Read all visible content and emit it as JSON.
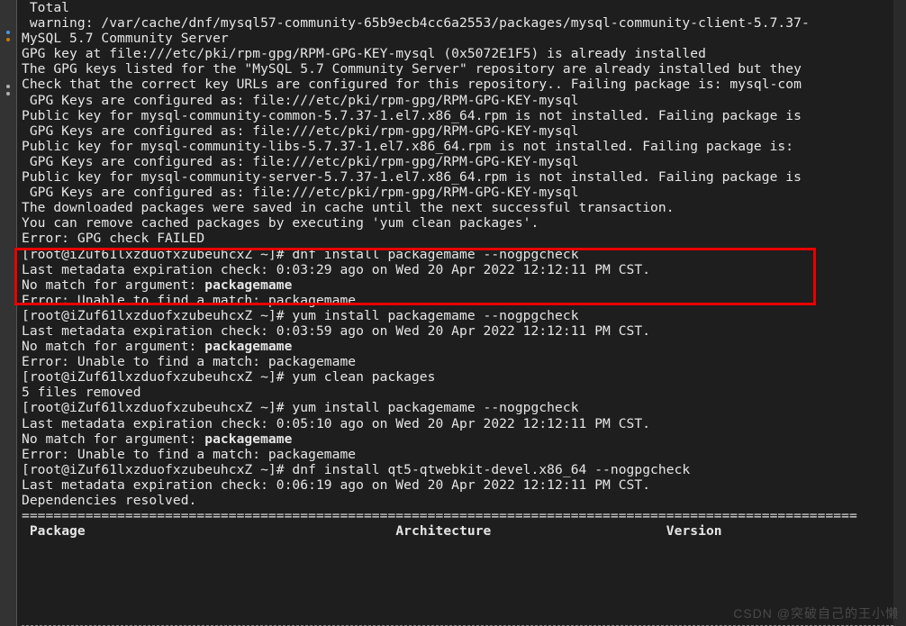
{
  "lines": [
    {
      "segs": [
        {
          "t": " Total"
        }
      ]
    },
    {
      "segs": [
        {
          "t": " warning: /var/cache/dnf/mysql57-community-65b9ecb4cc6a2553/packages/mysql-community-client-5.7.37-"
        }
      ]
    },
    {
      "segs": [
        {
          "t": "MySQL 5.7 Community Server"
        }
      ]
    },
    {
      "segs": [
        {
          "t": "GPG key at file:///etc/pki/rpm-gpg/RPM-GPG-KEY-mysql (0x5072E1F5) is already installed"
        }
      ]
    },
    {
      "segs": [
        {
          "t": "The GPG keys listed for the \"MySQL 5.7 Community Server\" repository are already installed but they"
        }
      ]
    },
    {
      "segs": [
        {
          "t": "Check that the correct key URLs are configured for this repository.. Failing package is: mysql-com"
        }
      ]
    },
    {
      "segs": [
        {
          "t": " GPG Keys are configured as: file:///etc/pki/rpm-gpg/RPM-GPG-KEY-mysql"
        }
      ]
    },
    {
      "segs": [
        {
          "t": "Public key for mysql-community-common-5.7.37-1.el7.x86_64.rpm is not installed. Failing package is"
        }
      ]
    },
    {
      "segs": [
        {
          "t": " GPG Keys are configured as: file:///etc/pki/rpm-gpg/RPM-GPG-KEY-mysql"
        }
      ]
    },
    {
      "segs": [
        {
          "t": "Public key for mysql-community-libs-5.7.37-1.el7.x86_64.rpm is not installed. Failing package is: "
        }
      ]
    },
    {
      "segs": [
        {
          "t": " GPG Keys are configured as: file:///etc/pki/rpm-gpg/RPM-GPG-KEY-mysql"
        }
      ]
    },
    {
      "segs": [
        {
          "t": "Public key for mysql-community-server-5.7.37-1.el7.x86_64.rpm is not installed. Failing package is"
        }
      ]
    },
    {
      "segs": [
        {
          "t": " GPG Keys are configured as: file:///etc/pki/rpm-gpg/RPM-GPG-KEY-mysql"
        }
      ]
    },
    {
      "segs": [
        {
          "t": "The downloaded packages were saved in cache until the next successful transaction."
        }
      ]
    },
    {
      "segs": [
        {
          "t": "You can remove cached packages by executing 'yum clean packages'."
        }
      ]
    },
    {
      "segs": [
        {
          "t": "Error: GPG check FAILED"
        }
      ]
    },
    {
      "segs": [
        {
          "t": "[root@iZuf61lxzduofxzubeuhcxZ ~]# dnf install packagemame --nogpgcheck"
        }
      ]
    },
    {
      "segs": [
        {
          "t": "Last metadata expiration check: 0:03:29 ago on Wed 20 Apr 2022 12:12:11 PM CST."
        }
      ]
    },
    {
      "segs": [
        {
          "t": "No match for argument: "
        },
        {
          "t": "packagemame",
          "b": true
        }
      ]
    },
    {
      "segs": [
        {
          "t": "Error: Unable to find a match: packagemame"
        }
      ]
    },
    {
      "segs": [
        {
          "t": "[root@iZuf61lxzduofxzubeuhcxZ ~]# yum install packagemame --nogpgcheck"
        }
      ]
    },
    {
      "segs": [
        {
          "t": "Last metadata expiration check: 0:03:59 ago on Wed 20 Apr 2022 12:12:11 PM CST."
        }
      ]
    },
    {
      "segs": [
        {
          "t": "No match for argument: "
        },
        {
          "t": "packagemame",
          "b": true
        }
      ]
    },
    {
      "segs": [
        {
          "t": "Error: Unable to find a match: packagemame"
        }
      ]
    },
    {
      "segs": [
        {
          "t": "[root@iZuf61lxzduofxzubeuhcxZ ~]# yum clean packages"
        }
      ]
    },
    {
      "segs": [
        {
          "t": "5 files removed"
        }
      ]
    },
    {
      "segs": [
        {
          "t": "[root@iZuf61lxzduofxzubeuhcxZ ~]# yum install packagemame --nogpgcheck"
        }
      ]
    },
    {
      "segs": [
        {
          "t": "Last metadata expiration check: 0:05:10 ago on Wed 20 Apr 2022 12:12:11 PM CST."
        }
      ]
    },
    {
      "segs": [
        {
          "t": "No match for argument: "
        },
        {
          "t": "packagemame",
          "b": true
        }
      ]
    },
    {
      "segs": [
        {
          "t": "Error: Unable to find a match: packagemame"
        }
      ]
    },
    {
      "segs": [
        {
          "t": "[root@iZuf61lxzduofxzubeuhcxZ ~]# dnf install qt5-qtwebkit-devel.x86_64 --nogpgcheck"
        }
      ]
    },
    {
      "segs": [
        {
          "t": "Last metadata expiration check: 0:06:19 ago on Wed 20 Apr 2022 12:12:11 PM CST."
        }
      ]
    },
    {
      "segs": [
        {
          "t": "Dependencies resolved."
        }
      ]
    },
    {
      "segs": [
        {
          "t": "========================================================================================================="
        }
      ]
    },
    {
      "segs": [
        {
          "t": " "
        },
        {
          "t": "Package",
          "b": true
        },
        {
          "t": "                                       "
        },
        {
          "t": "Architecture",
          "b": true
        },
        {
          "t": "                      "
        },
        {
          "t": "Version",
          "b": true
        }
      ]
    }
  ],
  "watermark": "CSDN @突破自己的王小懒",
  "sidebar_dots": [
    "#4c99e0",
    "#c97c00",
    "#b0b0b0",
    "#b0b0b0",
    "#333"
  ]
}
